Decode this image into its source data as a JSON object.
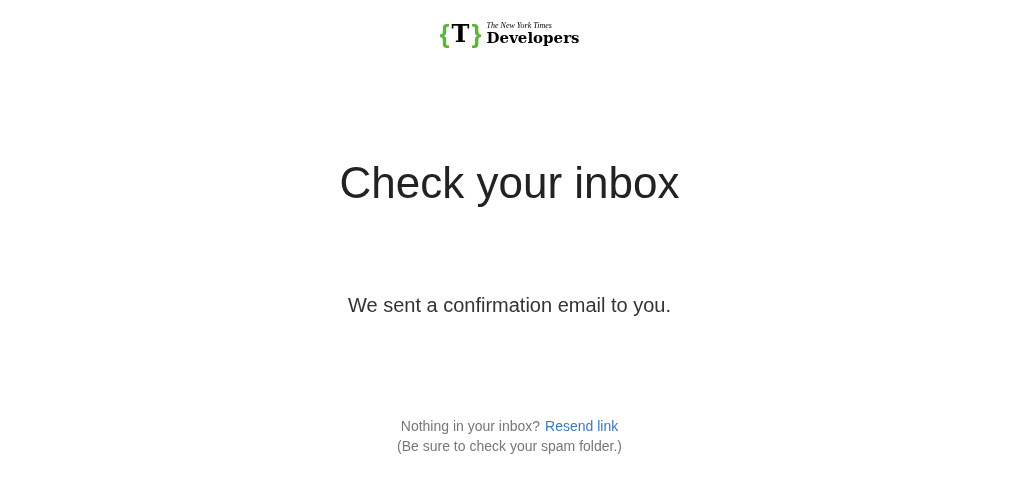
{
  "logo": {
    "open_brace": "{",
    "letter": "T",
    "close_brace": "}",
    "publisher": "The New York Times",
    "product": "Developers"
  },
  "heading": "Check your inbox",
  "message": "We sent a confirmation email to you.",
  "footer": {
    "question": "Nothing in your inbox?",
    "link": "Resend link",
    "note": "(Be sure to check your spam folder.)"
  }
}
